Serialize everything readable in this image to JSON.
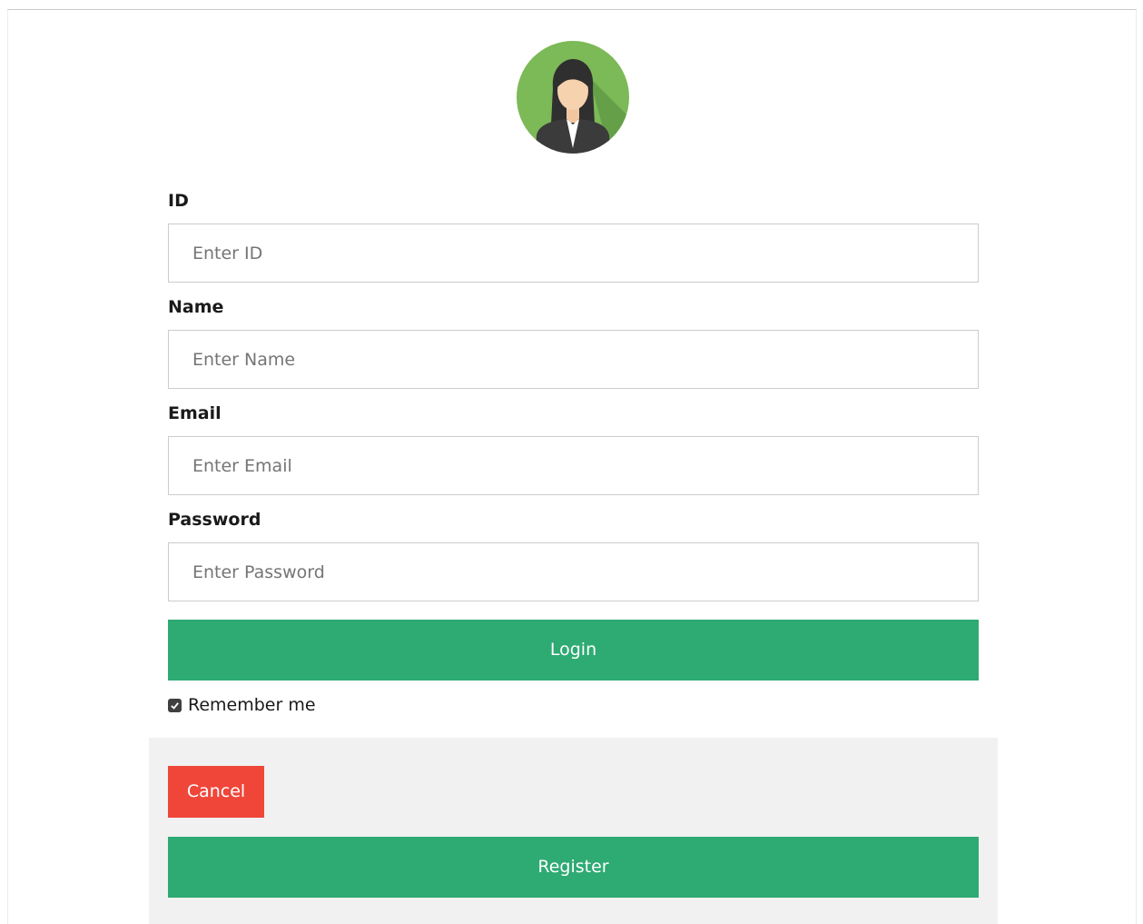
{
  "avatar": {
    "icon": "user-avatar-woman-icon",
    "bg_color": "#7cb957"
  },
  "form": {
    "id": {
      "label": "ID",
      "placeholder": "Enter ID",
      "value": ""
    },
    "name": {
      "label": "Name",
      "placeholder": "Enter Name",
      "value": ""
    },
    "email": {
      "label": "Email",
      "placeholder": "Enter Email",
      "value": ""
    },
    "password": {
      "label": "Password",
      "placeholder": "Enter Password",
      "value": ""
    },
    "login_label": "Login",
    "remember": {
      "label": "Remember me",
      "checked": true
    }
  },
  "footer": {
    "cancel_label": "Cancel",
    "register_label": "Register"
  },
  "colors": {
    "primary_green": "#2eaa73",
    "cancel_red": "#f0463a",
    "panel_grey": "#f1f1f1"
  }
}
